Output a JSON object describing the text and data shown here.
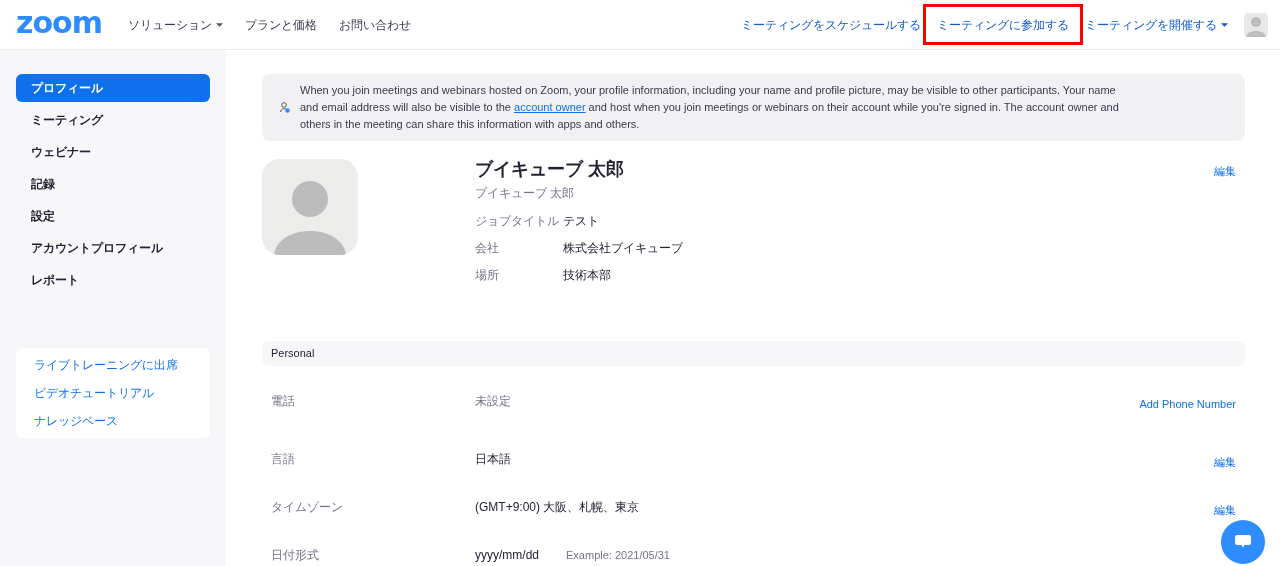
{
  "header": {
    "logo": "zoom",
    "nav": [
      {
        "label": "ソリューション",
        "dropdown": true
      },
      {
        "label": "プランと価格",
        "dropdown": false
      },
      {
        "label": "お問い合わせ",
        "dropdown": false
      }
    ],
    "actions": [
      {
        "label": "ミーティングをスケジュールする",
        "dropdown": false,
        "highlighted": false
      },
      {
        "label": "ミーティングに参加する",
        "dropdown": false,
        "highlighted": true
      },
      {
        "label": "ミーティングを開催する",
        "dropdown": true,
        "highlighted": false
      }
    ]
  },
  "sidebar": {
    "items": [
      {
        "label": "プロフィール",
        "selected": true
      },
      {
        "label": "ミーティング",
        "selected": false
      },
      {
        "label": "ウェビナー",
        "selected": false
      },
      {
        "label": "記録",
        "selected": false
      },
      {
        "label": "設定",
        "selected": false
      },
      {
        "label": "アカウントプロフィール",
        "selected": false
      },
      {
        "label": "レポート",
        "selected": false
      }
    ],
    "help_links": [
      "ライブトレーニングに出席",
      "ビデオチュートリアル",
      "ナレッジベース"
    ]
  },
  "notice": {
    "before": "When you join meetings and webinars hosted on Zoom, your profile information, including your name and profile picture, may be visible to other participants. Your name and email address will also be visible to the",
    "link": "account owner",
    "after": "and host when you join meetings or webinars on their account while you're signed in. The account owner and others in the meeting can share this information with apps and others."
  },
  "profile": {
    "name": "ブイキューブ 太郎",
    "subname": "ブイキューブ 太郎",
    "edit": "編集",
    "fields": [
      {
        "label": "ジョブタイトル",
        "value": "テスト"
      },
      {
        "label": "会社",
        "value": "株式会社ブイキューブ"
      },
      {
        "label": "場所",
        "value": "技術本部"
      }
    ]
  },
  "personal": {
    "title": "Personal",
    "rows": [
      {
        "label": "電話",
        "value": "未設定",
        "note": null,
        "action": "Add Phone Number",
        "muted": true
      },
      {
        "label": "言語",
        "value": "日本語",
        "note": null,
        "action": "編集",
        "muted": false
      },
      {
        "label": "タイムゾーン",
        "value": "(GMT+9:00) 大阪、札幌、東京",
        "note": null,
        "action": "編集",
        "muted": false
      },
      {
        "label": "日付形式",
        "value": "yyyy/mm/dd",
        "note": "Example: 2021/05/31",
        "action": null,
        "muted": false
      }
    ]
  }
}
